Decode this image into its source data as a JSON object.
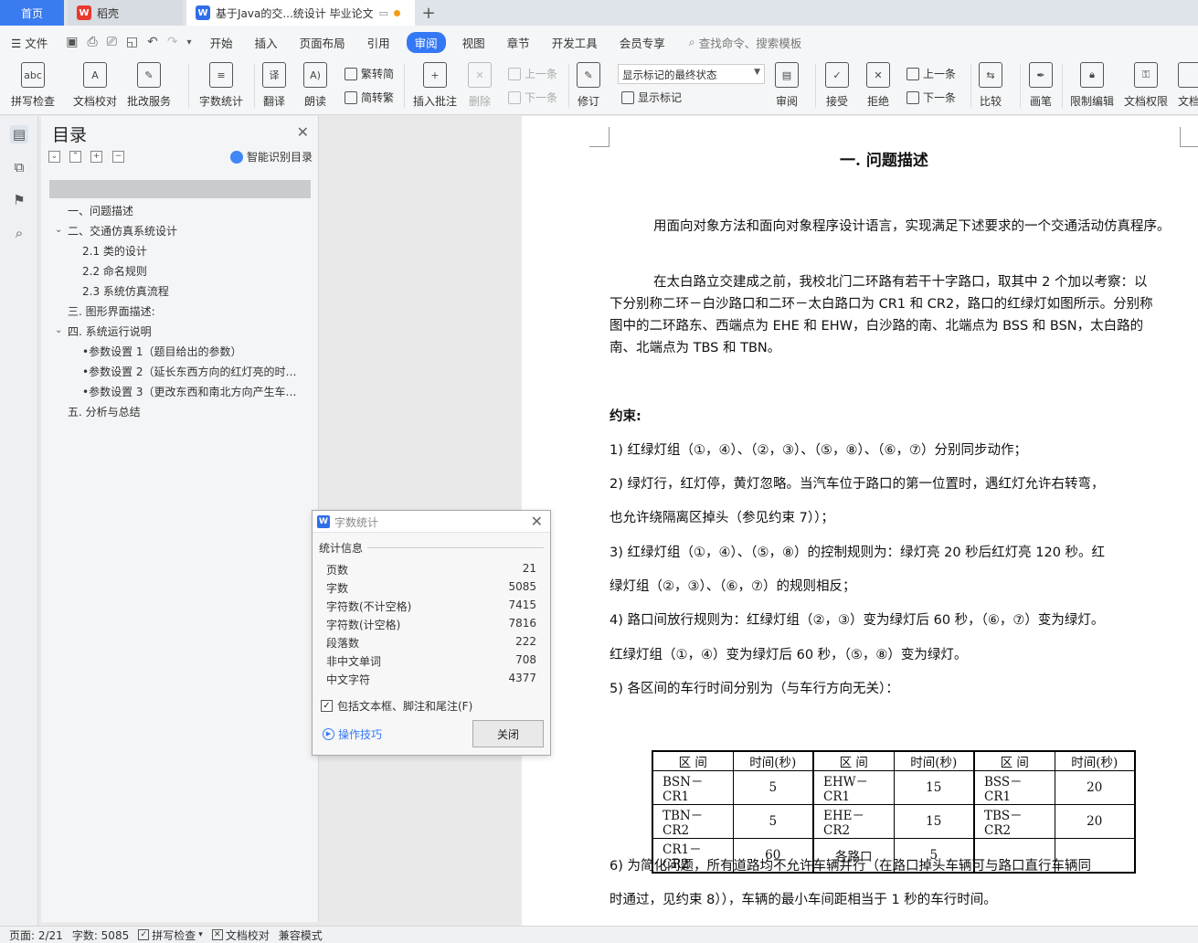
{
  "tabs": {
    "home": "首页",
    "daoke": "稻壳",
    "document": "基于Java的交...统设计 毕业论文",
    "add": "+"
  },
  "menu": {
    "file": "文件",
    "items": [
      "开始",
      "插入",
      "页面布局",
      "引用",
      "审阅",
      "视图",
      "章节",
      "开发工具",
      "会员专享"
    ],
    "active": "审阅",
    "search": "查找命令、搜索模板"
  },
  "ribbon": {
    "spellcheck": "拼写检查",
    "doc_proof": "文档校对",
    "annotate_service": "批改服务",
    "word_count": "字数统计",
    "translate": "翻译",
    "read_aloud": "朗读",
    "trad_to_simp": "繁转简",
    "simp_to_trad": "简转繁",
    "insert_comment": "插入批注",
    "delete": "删除",
    "prev_comment": "上一条",
    "next_comment": "下一条",
    "revise": "修订",
    "markup_state": "显示标记的最终状态",
    "show_markup": "显示标记",
    "review": "审阅",
    "accept": "接受",
    "reject": "拒绝",
    "prev_change": "上一条",
    "next_change": "下一条",
    "compare": "比较",
    "pen": "画笔",
    "restrict_edit": "限制编辑",
    "doc_permission": "文档权限",
    "doc_cut": "文档"
  },
  "toc": {
    "title": "目录",
    "smart": "智能识别目录",
    "items": [
      "一、问题描述",
      "二、交通仿真系统设计",
      "2.1 类的设计",
      "2.2 命名规则",
      "2.3 系统仿真流程",
      "三. 图形界面描述:",
      "四. 系统运行说明",
      "•参数设置 1（题目给出的参数）",
      "•参数设置 2（延长东西方向的红灯亮的时…",
      "•参数设置 3（更改东西和南北方向产生车…",
      "五. 分析与总结"
    ]
  },
  "document": {
    "heading": "一.    问题描述",
    "para1": "用面向对象方法和面向对象程序设计语言，实现满足下述要求的一个交通活动仿真程序。",
    "para2": "在太白路立交建成之前，我校北门二环路有若干十字路口，取其中 2 个加以考察：以下分别称二环－白沙路口和二环－太白路口为 CR1 和 CR2，路口的红绿灯如图所示。分别称图中的二环路东、西端点为 EHE 和 EHW，白沙路的南、北端点为 BSS 和 BSN，太白路的南、北端点为 TBS 和 TBN。",
    "constraint_title": "约束:",
    "lines": [
      "1) 红绿灯组（①，④）、（②，③）、（⑤，⑧）、（⑥，⑦）分别同步动作；",
      "2) 绿灯行，红灯停，黄灯忽略。当汽车位于路口的第一位置时，遇红灯允许右转弯，",
      "也允许绕隔离区掉头（参见约束 7））；",
      "3) 红绿灯组（①，④）、（⑤，⑧）的控制规则为：绿灯亮 20 秒后红灯亮 120 秒。红",
      "绿灯组（②，③）、（⑥，⑦）的规则相反；",
      "4) 路口间放行规则为：红绿灯组（②，③）变为绿灯后 60 秒，（⑥，⑦）变为绿灯。",
      "红绿灯组（①，④）变为绿灯后 60 秒，（⑤，⑧）变为绿灯。",
      "5) 各区间的车行时间分别为（与车行方向无关）："
    ],
    "table": {
      "headers": [
        "区  间",
        "时间(秒)",
        "区  间",
        "时间(秒)",
        "区  间",
        "时间(秒)"
      ],
      "rows": [
        [
          "BSN－CR1",
          "5",
          "EHW－CR1",
          "15",
          "BSS－CR1",
          "20"
        ],
        [
          "TBN－CR2",
          "5",
          "EHE－CR2",
          "15",
          "TBS－CR2",
          "20"
        ],
        [
          "CR1－CR2",
          "60",
          "各路口",
          "5",
          "",
          ""
        ]
      ]
    },
    "line6a": "6) 为简化问题，所有道路均不允许车辆并行（在路口掉头车辆可与路口直行车辆同",
    "line6b": "时通过，见约束 8）），车辆的最小车间距相当于 1 秒的车行时间。"
  },
  "dialog": {
    "title": "字数统计",
    "section": "统计信息",
    "stats": [
      {
        "label": "页数",
        "value": "21"
      },
      {
        "label": "字数",
        "value": "5085"
      },
      {
        "label": "字符数(不计空格)",
        "value": "7415"
      },
      {
        "label": "字符数(计空格)",
        "value": "7816"
      },
      {
        "label": "段落数",
        "value": "222"
      },
      {
        "label": "非中文单词",
        "value": "708"
      },
      {
        "label": "中文字符",
        "value": "4377"
      }
    ],
    "include_label": "包括文本框、脚注和尾注(F)",
    "tips": "操作技巧",
    "close": "关闭"
  },
  "status": {
    "page": "页面: 2/21",
    "words": "字数: 5085",
    "spell": "拼写检查",
    "proof": "文档校对",
    "compat": "兼容模式"
  }
}
